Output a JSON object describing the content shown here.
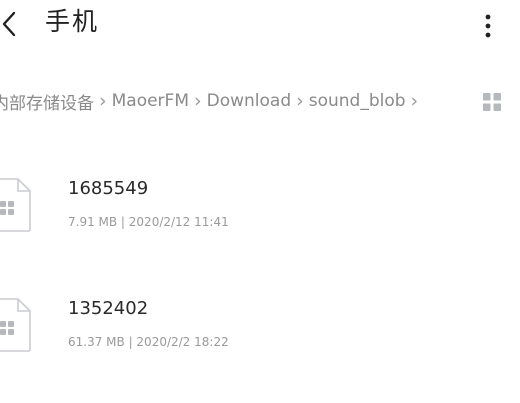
{
  "header": {
    "back_icon": "chevron-left-icon",
    "title": "手机",
    "more_icon": "more-vertical-icon"
  },
  "breadcrumb": {
    "items": [
      {
        "label": "内部存储设备"
      },
      {
        "label": "MaoerFM"
      },
      {
        "label": "Download"
      },
      {
        "label": "sound_blob"
      }
    ],
    "separator": "›",
    "view_icon": "grid-view-icon"
  },
  "files": [
    {
      "name": "1685549",
      "meta": "7.91 MB | 2020/2/12 11:41",
      "icon": "file-icon"
    },
    {
      "name": "1352402",
      "meta": "61.37 MB | 2020/2/2 18:22",
      "icon": "file-icon"
    }
  ],
  "colors": {
    "background": "#ffffff",
    "text_primary": "#2a2a2a",
    "text_secondary": "#9a9a9a",
    "icon_gray": "#b5b8bd"
  }
}
